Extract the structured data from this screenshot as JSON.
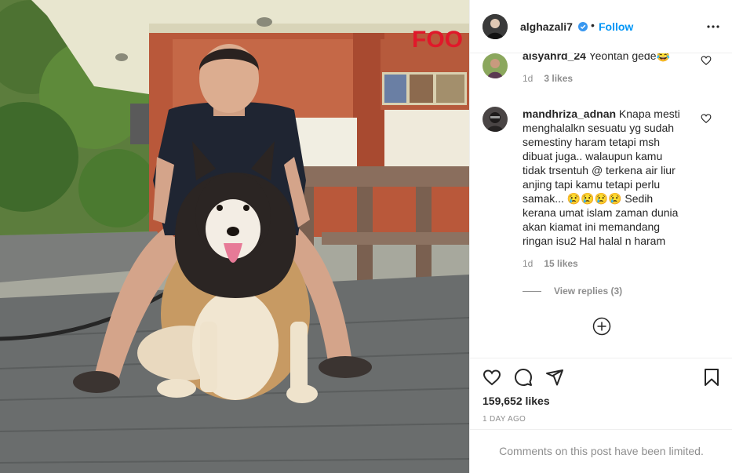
{
  "post": {
    "image_alt": "Young man in navy t-shirt sitting behind a large fluffy black, white and tan dog on a wooden deck",
    "sign_text": "FOO"
  },
  "header": {
    "username": "alghazali7",
    "separator": "•",
    "follow_label": "Follow"
  },
  "comments": [
    {
      "username": "aisyahrd_24",
      "text": "Yeontan gede😂",
      "age": "1d",
      "likes": "3 likes"
    },
    {
      "username": "mandhriza_adnan",
      "text": "Knapa mesti menghalalkn sesuatu yg sudah semestiny haram tetapi msh dibuat juga.. walaupun kamu tidak trsentuh @ terkena air liur anjing tapi kamu tetapi perlu samak... 😢😢😢😢 Sedih kerana umat islam zaman dunia akan kiamat ini memandang ringan isu2 Hal halal n haram",
      "age": "1d",
      "likes": "15 likes",
      "view_replies": "View replies (3)"
    }
  ],
  "actions": {
    "likes_count": "159,652 likes",
    "timestamp": "1 DAY AGO"
  },
  "footer": {
    "limited_text": "Comments on this post have been limited."
  },
  "colors": {
    "accent": "#0095f6",
    "secondary_text": "#8e8e8e",
    "primary_text": "#262626",
    "divider": "#efefef"
  }
}
